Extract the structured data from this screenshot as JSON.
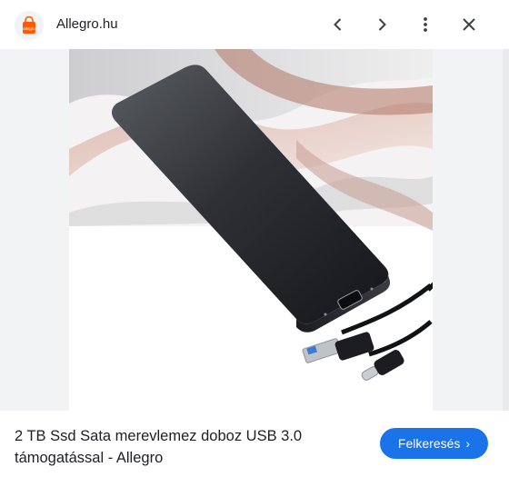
{
  "header": {
    "site_name": "Allegro.hu",
    "logo_icon": "allegro-shopping-bag-icon",
    "brand_color": "#ff5a00",
    "buttons": [
      {
        "name": "previous-button",
        "icon": "chevron-left-icon"
      },
      {
        "name": "next-button",
        "icon": "chevron-right-icon"
      },
      {
        "name": "more-options-button",
        "icon": "more-vertical-icon"
      },
      {
        "name": "close-button",
        "icon": "close-icon"
      }
    ]
  },
  "image": {
    "subject": "external-ssd-enclosure-with-usb-cables",
    "type": "product-photo"
  },
  "caption": {
    "title": "2 TB Ssd Sata merevlemez doboz USB 3.0 támogatással - Allegro"
  },
  "actions": {
    "visit_label": "Felkeresés",
    "visit_icon": "chevron-right-icon",
    "accent_color": "#1a73e8"
  }
}
